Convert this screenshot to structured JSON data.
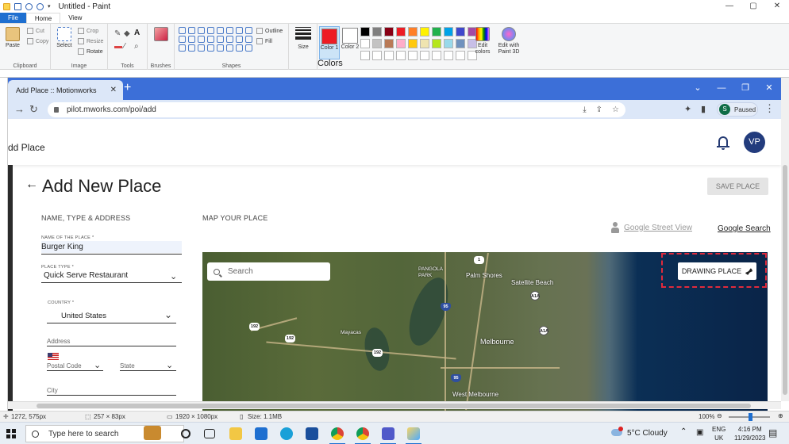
{
  "paint": {
    "window_title": "Untitled - Paint",
    "tabs": [
      "File",
      "Home",
      "View"
    ],
    "groups": {
      "clipboard": {
        "label": "Clipboard",
        "paste": "Paste",
        "cut": "Cut",
        "copy": "Copy"
      },
      "image": {
        "label": "Image",
        "select": "Select",
        "crop": "Crop",
        "resize": "Resize",
        "rotate": "Rotate"
      },
      "tools": {
        "label": "Tools"
      },
      "brushes": {
        "label": "Brushes"
      },
      "shapes": {
        "label": "Shapes",
        "outline": "Outline",
        "fill": "Fill"
      },
      "size": {
        "label": "Size"
      },
      "colors": {
        "label": "Colors",
        "color1_label": "Color 1",
        "color2_label": "Color 2",
        "edit_colors": "Edit colors",
        "edit_paint3d": "Edit with Paint 3D",
        "color1": "#ed1c24",
        "color2": "#ffffff",
        "palette": [
          "#000000",
          "#7f7f7f",
          "#880015",
          "#ed1c24",
          "#ff7f27",
          "#fff200",
          "#22b14c",
          "#00a2e8",
          "#3f48cc",
          "#a349a4",
          "#ffffff",
          "#c3c3c3",
          "#b97a57",
          "#ffaec9",
          "#ffc90e",
          "#efe4b0",
          "#b5e61d",
          "#99d9ea",
          "#7092be",
          "#c8bfe7",
          "#ffffff",
          "#ffffff",
          "#ffffff",
          "#ffffff",
          "#ffffff",
          "#ffffff",
          "#ffffff",
          "#ffffff",
          "#ffffff",
          "#ffffff"
        ]
      }
    },
    "status": {
      "cursor_pos": "1272, 575px",
      "selection_size": "257 × 83px",
      "canvas_size": "1920 × 1080px",
      "file_size": "Size: 1.1MB",
      "zoom": "100%"
    }
  },
  "browser": {
    "tab_title": "Add Place :: Motionworks",
    "url": "pilot.mworks.com/poi/add",
    "profile_initial": "S",
    "profile_status": "Paused"
  },
  "page": {
    "breadcrumb": "dd Place",
    "avatar_initials": "VP",
    "title": "Add New Place",
    "save_button": "SAVE PLACE",
    "section_left": "NAME, TYPE & ADDRESS",
    "section_right": "MAP YOUR PLACE",
    "name_label": "NAME OF THE PLACE *",
    "name_value": "Burger King",
    "type_label": "PLACE TYPE *",
    "type_value": "Quick Serve Restaurant",
    "country_label": "COUNTRY *",
    "country_value": "United States",
    "address_placeholder": "Address",
    "postal_placeholder": "Postal Code",
    "state_placeholder": "State",
    "city_placeholder": "City",
    "street_view_link": "Google Street View",
    "google_search_link": "Google Search",
    "map": {
      "search_placeholder": "Search",
      "drawing_button": "DRAWING PLACE",
      "labels": {
        "palm_shores": "Palm Shores",
        "satellite_beach": "Satellite Beach",
        "melbourne": "Melbourne",
        "west_melbourne": "West Melbourne",
        "mayacas": "Mayacas",
        "pangola_park": "PANGOLA\nPARK"
      },
      "shields": {
        "r1": "1",
        "r192a": "192",
        "r192b": "192",
        "r192c": "192",
        "i95a": "95",
        "i95b": "95",
        "a1a1": "A1A",
        "a1a2": "A1A"
      }
    }
  },
  "taskbar": {
    "search_placeholder": "Type here to search",
    "weather": "5°C  Cloudy",
    "lang1": "ENG",
    "lang2": "UK",
    "time": "4:16 PM",
    "date": "11/29/2023"
  }
}
